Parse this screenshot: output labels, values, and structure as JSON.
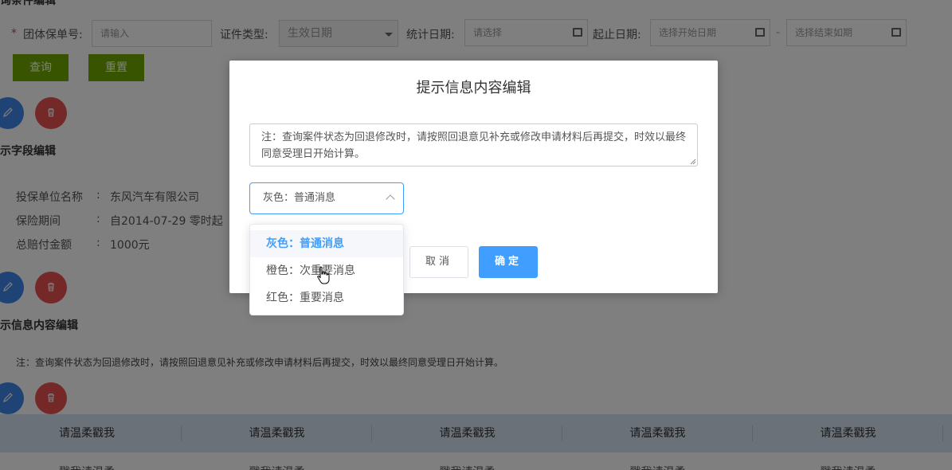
{
  "filter": {
    "section_title": "查询条件编辑",
    "required_mark": "*",
    "group_policy_label": "团体保单号:",
    "group_policy_placeholder": "请输入",
    "cert_type_label": "证件类型:",
    "cert_type_value": "生效日期",
    "stat_date_label": "统计日期:",
    "stat_date_placeholder": "请选择",
    "range_label": "起止日期:",
    "range_start_placeholder": "选择开始日期",
    "range_sep": "-",
    "range_end_placeholder": "选择结束如期",
    "query_button": "查询",
    "reset_button": "重置"
  },
  "field_section": {
    "title": "提示字段编辑",
    "rows": [
      {
        "label": "投保单位名称",
        "sep": ":",
        "value": "东风汽车有限公司"
      },
      {
        "label": "保险期间",
        "sep": ":",
        "value": "自2014-07-29 零时起"
      },
      {
        "label": "总赔付金额",
        "sep": ":",
        "value": "1000元"
      }
    ]
  },
  "notice_section": {
    "title": "提示信息内容编辑",
    "text": "注：查询案件状态为回退修改时，请按照回退意见补充或修改申请材料后再提交，时效以最终同意受理日开始计算。"
  },
  "table": {
    "headers": [
      "请温柔戳我",
      "请温柔戳我",
      "请温柔戳我",
      "请温柔戳我",
      "请温柔戳我"
    ],
    "first_row": [
      "戳我请温柔",
      "戳我请温柔",
      "戳我请温柔",
      "戳我请温柔",
      "戳我请温柔"
    ]
  },
  "modal": {
    "title": "提示信息内容编辑",
    "textarea_value": "注：查询案件状态为回退修改时，请按照回退意见补充或修改申请材料后再提交，时效以最终同意受理日开始计算。",
    "select_value": "灰色：普通消息",
    "cancel_button": "取消",
    "ok_button": "确定",
    "options": [
      "灰色：普通消息",
      "橙色：次重要消息",
      "红色：重要消息"
    ],
    "selected_option_index": 0
  },
  "colors": {
    "primary": "#409eff",
    "green_button": "#70a800",
    "edit_circle": "#3d86e8",
    "delete_circle": "#e85050",
    "table_header": "#d4e3f3"
  }
}
